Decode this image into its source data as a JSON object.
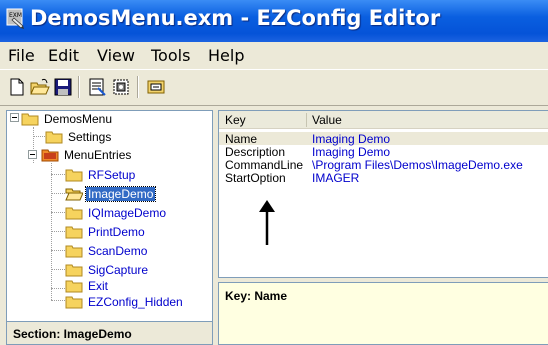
{
  "window": {
    "title": "DemosMenu.exm - EZConfig Editor",
    "icon": "ezm-app-icon"
  },
  "menubar": {
    "items": [
      "File",
      "Edit",
      "View",
      "Tools",
      "Help"
    ]
  },
  "toolbar": {
    "buttons": [
      "new-icon",
      "open-icon",
      "save-icon",
      "properties-icon",
      "settings-icon",
      "deploy-icon"
    ]
  },
  "tree": {
    "nodes": [
      {
        "label": "DemosMenu"
      },
      {
        "label": "Settings"
      },
      {
        "label": "MenuEntries"
      },
      {
        "label": "RFSetup"
      },
      {
        "label": "ImageDemo"
      },
      {
        "label": "IQImageDemo"
      },
      {
        "label": "PrintDemo"
      },
      {
        "label": "ScanDemo"
      },
      {
        "label": "SigCapture"
      },
      {
        "label": "Exit"
      },
      {
        "label": "EZConfig_Hidden"
      }
    ],
    "selected": "ImageDemo"
  },
  "status": {
    "section": "Section: ImageDemo"
  },
  "list": {
    "columns": [
      "Key",
      "Value"
    ],
    "rows": [
      {
        "key": "Name",
        "value": "Imaging Demo"
      },
      {
        "key": "Description",
        "value": "Imaging Demo"
      },
      {
        "key": "CommandLine",
        "value": "\\Program Files\\Demos\\ImageDemo.exe"
      },
      {
        "key": "StartOption",
        "value": "IMAGER"
      }
    ]
  },
  "description": {
    "text": "Key: Name"
  },
  "colors": {
    "titlebar": "#0553d8",
    "selection": "#316ac5",
    "value_text": "#0000cc",
    "description_bg": "#ffffe1"
  }
}
